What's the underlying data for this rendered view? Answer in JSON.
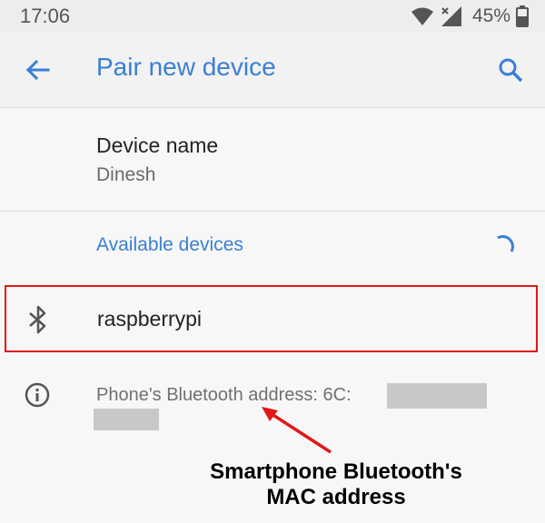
{
  "status_bar": {
    "time": "17:06",
    "battery_percent": "45%",
    "icons": [
      "wifi-icon",
      "no-signal-icon",
      "battery-icon"
    ]
  },
  "app_bar": {
    "title": "Pair new device",
    "back_icon": "arrow-back-icon",
    "search_icon": "search-icon"
  },
  "device_name": {
    "title": "Device name",
    "value": "Dinesh"
  },
  "available_devices": {
    "header": "Available devices",
    "devices": [
      {
        "name": "raspberrypi",
        "icon": "bluetooth-icon"
      }
    ]
  },
  "info": {
    "icon": "info-icon",
    "text": "Phone's Bluetooth address: 6C:"
  },
  "annotation": {
    "line1": "Smartphone Bluetooth's",
    "line2": "MAC address"
  },
  "colors": {
    "accent": "#3a7fd5",
    "highlight_border": "#e01818",
    "redaction": "#c8c8c8"
  }
}
